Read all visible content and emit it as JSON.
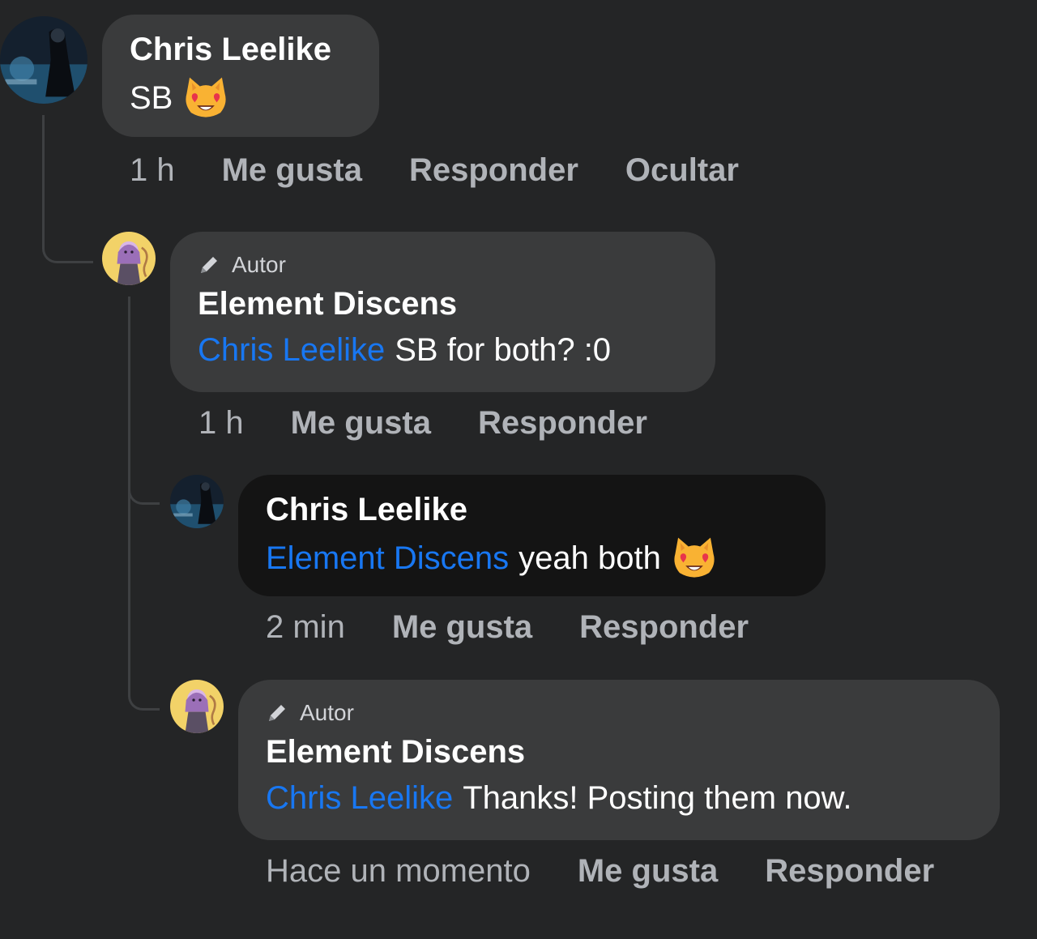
{
  "comments": [
    {
      "author": "Chris Leelike",
      "text": "SB",
      "emoji": "smiling-cat-heart-eyes-icon",
      "time": "1 h",
      "actions": [
        "Me gusta",
        "Responder",
        "Ocultar"
      ]
    },
    {
      "badge": "Autor",
      "author": "Element Discens",
      "mention": "Chris Leelike",
      "text": "SB for both? :0",
      "time": "1 h",
      "actions": [
        "Me gusta",
        "Responder"
      ]
    },
    {
      "author": "Chris Leelike",
      "mention": "Element Discens",
      "text": "yeah both",
      "emoji": "smiling-cat-heart-eyes-icon",
      "time": "2 min",
      "actions": [
        "Me gusta",
        "Responder"
      ]
    },
    {
      "badge": "Autor",
      "author": "Element Discens",
      "mention": "Chris Leelike",
      "text": "Thanks! Posting them now.",
      "time": "Hace un momento",
      "actions": [
        "Me gusta",
        "Responder"
      ]
    }
  ],
  "colors": {
    "background": "#242526",
    "bubble": "#3a3b3c",
    "highlighted_bubble": "#141414",
    "mention": "#1877f2",
    "secondary_text": "#b0b3b8"
  }
}
